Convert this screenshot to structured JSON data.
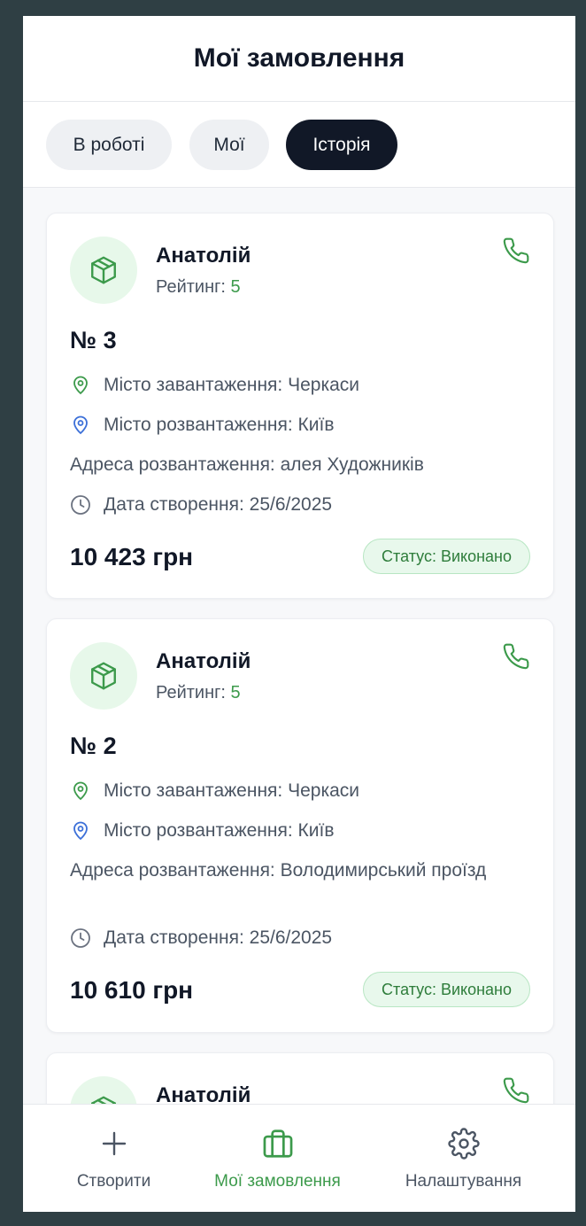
{
  "header": {
    "title": "Мої замовлення"
  },
  "tabs": [
    {
      "label": "В роботі",
      "active": false
    },
    {
      "label": "Мої",
      "active": false
    },
    {
      "label": "Історія",
      "active": true
    }
  ],
  "orders": [
    {
      "name": "Анатолій",
      "rating_label": "Рейтинг:",
      "rating_value": "5",
      "number": "№ 3",
      "loading_city": "Місто завантаження: Черкаси",
      "unloading_city": "Місто розвантаження: Київ",
      "unloading_address": "Адреса розвантаження: алея Художників",
      "created": "Дата створення: 25/6/2025",
      "price": "10 423 грн",
      "status": "Статус: Виконано"
    },
    {
      "name": "Анатолій",
      "rating_label": "Рейтинг:",
      "rating_value": "5",
      "number": "№ 2",
      "loading_city": "Місто завантаження: Черкаси",
      "unloading_city": "Місто розвантаження: Київ",
      "unloading_address": "Адреса розвантаження: Володимирський проїзд",
      "created": "Дата створення: 25/6/2025",
      "price": "10 610 грн",
      "status": "Статус: Виконано"
    },
    {
      "name": "Анатолій"
    }
  ],
  "bottom_nav": [
    {
      "label": "Створити",
      "icon": "plus-icon",
      "active": false
    },
    {
      "label": "Мої замовлення",
      "icon": "briefcase-icon",
      "active": true
    },
    {
      "label": "Налаштування",
      "icon": "gear-icon",
      "active": false
    }
  ],
  "colors": {
    "accent_green": "#3c9a4b",
    "pin_blue": "#3b6fd8",
    "dark": "#111827",
    "status_bg": "#e8f8ec"
  }
}
